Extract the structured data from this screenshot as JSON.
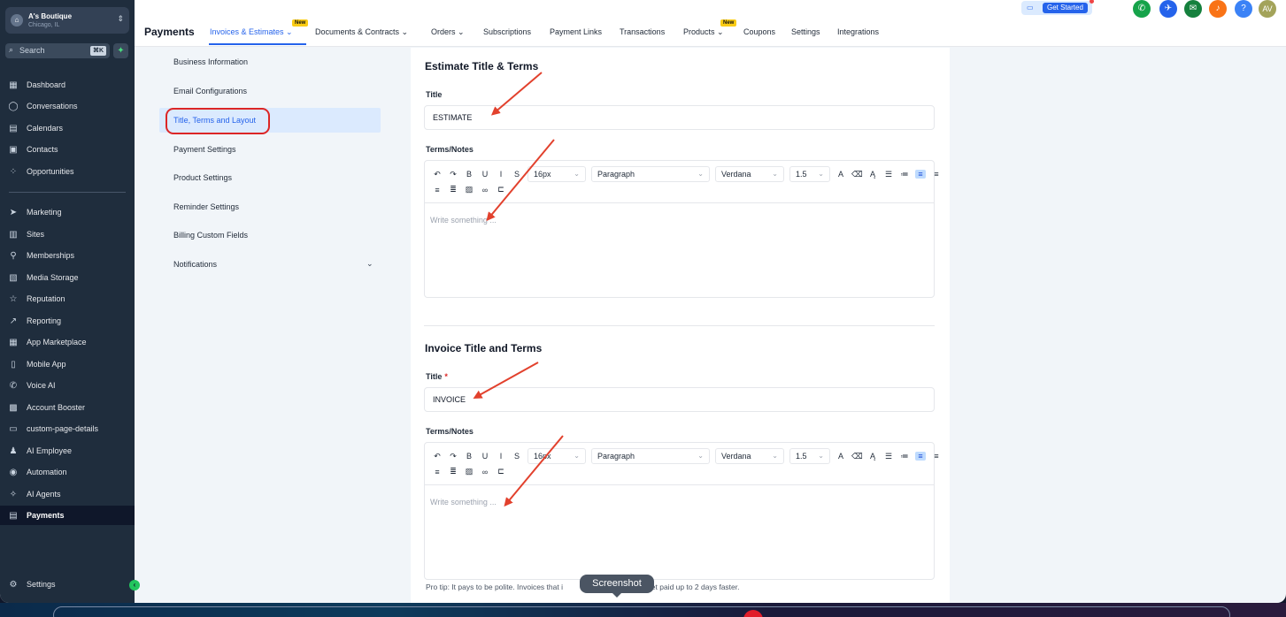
{
  "account": {
    "name": "A's Boutique",
    "location": "Chicago, IL"
  },
  "search": {
    "placeholder": "Search",
    "shortcut": "⌘K"
  },
  "sidebar": {
    "items": [
      {
        "label": "Dashboard",
        "icon": "dashboard-icon",
        "glyph": "▦"
      },
      {
        "label": "Conversations",
        "icon": "chat-icon",
        "glyph": "◯"
      },
      {
        "label": "Calendars",
        "icon": "calendar-icon",
        "glyph": "▤"
      },
      {
        "label": "Contacts",
        "icon": "contacts-icon",
        "glyph": "▣"
      },
      {
        "label": "Opportunities",
        "icon": "opportunities-icon",
        "glyph": "⁘"
      },
      {
        "label": "Marketing",
        "icon": "send-icon",
        "glyph": "➤"
      },
      {
        "label": "Sites",
        "icon": "sites-icon",
        "glyph": "▥"
      },
      {
        "label": "Memberships",
        "icon": "award-icon",
        "glyph": "⚲"
      },
      {
        "label": "Media Storage",
        "icon": "image-icon",
        "glyph": "▧"
      },
      {
        "label": "Reputation",
        "icon": "star-icon",
        "glyph": "☆"
      },
      {
        "label": "Reporting",
        "icon": "trend-icon",
        "glyph": "↗"
      },
      {
        "label": "App Marketplace",
        "icon": "grid-icon",
        "glyph": "▦"
      },
      {
        "label": "Mobile App",
        "icon": "mobile-icon",
        "glyph": "▯"
      },
      {
        "label": "Voice AI",
        "icon": "phone-icon",
        "glyph": "✆"
      },
      {
        "label": "Account Booster",
        "icon": "booster-icon",
        "glyph": "▩"
      },
      {
        "label": "custom-page-details",
        "icon": "page-icon",
        "glyph": "▭"
      },
      {
        "label": "AI Employee",
        "icon": "person-icon",
        "glyph": "♟"
      },
      {
        "label": "Automation",
        "icon": "automation-icon",
        "glyph": "◉"
      },
      {
        "label": "AI Agents",
        "icon": "sparkle-icon",
        "glyph": "✧"
      },
      {
        "label": "Payments",
        "icon": "receipt-icon",
        "glyph": "▤"
      }
    ],
    "settings_label": "Settings"
  },
  "topbar": {
    "title": "Payments",
    "tabs": [
      {
        "label": "Invoices & Estimates",
        "chevron": true,
        "badge": "New"
      },
      {
        "label": "Documents & Contracts",
        "chevron": true
      },
      {
        "label": "Orders",
        "chevron": true
      },
      {
        "label": "Subscriptions"
      },
      {
        "label": "Payment Links"
      },
      {
        "label": "Transactions"
      },
      {
        "label": "Products",
        "chevron": true,
        "badge": "New"
      },
      {
        "label": "Coupons"
      },
      {
        "label": "Settings"
      },
      {
        "label": "Integrations"
      }
    ],
    "get_started": "Get Started",
    "avatar_initials": "AV"
  },
  "colors": {
    "accent": "#2563eb",
    "sidebar_bg": "#1f2d3d",
    "annotation": "#e2412d",
    "phone": "#16a34a",
    "launch": "#2563eb",
    "megaphone": "#15803d",
    "bell": "#f97316",
    "help": "#3b82f6",
    "avatar": "#a3a35a"
  },
  "subnav": {
    "items": [
      "Business Information",
      "Email Configurations",
      "Title, Terms and Layout",
      "Payment Settings",
      "Product Settings",
      "Reminder Settings",
      "Billing Custom Fields",
      "Notifications"
    ],
    "active_index": 2
  },
  "estimate": {
    "section_title": "Estimate Title & Terms",
    "title_label": "Title",
    "title_value": "ESTIMATE",
    "terms_label": "Terms/Notes",
    "font_size": "16px",
    "block": "Paragraph",
    "font": "Verdana",
    "line_height": "1.5",
    "placeholder": "Write something ..."
  },
  "invoice": {
    "section_title": "Invoice Title and Terms",
    "title_label": "Title",
    "title_value": "INVOICE",
    "terms_label": "Terms/Notes",
    "font_size": "16px",
    "block": "Paragraph",
    "font": "Verdana",
    "line_height": "1.5",
    "placeholder": "Write something ..."
  },
  "protip": {
    "before": "Pro tip: It pays to be polite. Invoices that i",
    "after": "“thanks” get paid up to 2 days faster."
  },
  "tooltip": "Screenshot"
}
